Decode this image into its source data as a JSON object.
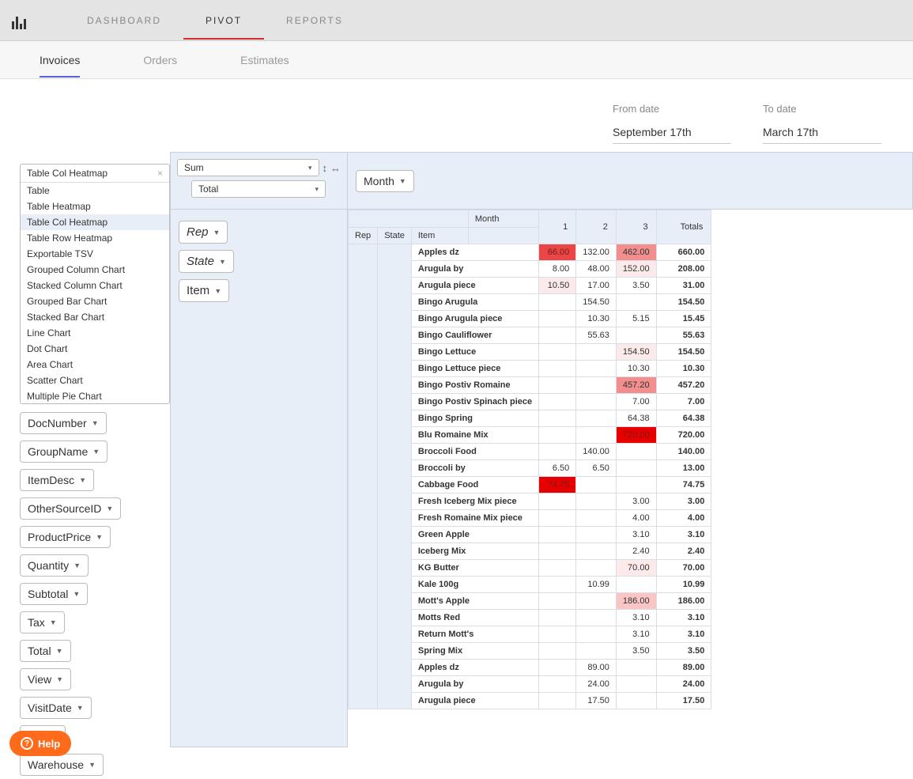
{
  "topTabs": [
    "DASHBOARD",
    "PIVOT",
    "REPORTS"
  ],
  "topActive": 1,
  "subTabs": [
    "Invoices",
    "Orders",
    "Estimates"
  ],
  "subActive": 0,
  "dates": {
    "fromLabel": "From date",
    "fromVal": "September 17th",
    "toLabel": "To date",
    "toVal": "March 17th"
  },
  "chartTypeSelected": "Table Col Heatmap",
  "chartTypes": [
    "Table",
    "Table Heatmap",
    "Table Col Heatmap",
    "Table Row Heatmap",
    "Exportable TSV",
    "Grouped Column Chart",
    "Stacked Column Chart",
    "Grouped Bar Chart",
    "Stacked Bar Chart",
    "Line Chart",
    "Dot Chart",
    "Area Chart",
    "Scatter Chart",
    "Multiple Pie Chart"
  ],
  "chartTypeSelIndex": 2,
  "aggFn": "Sum",
  "aggField": "Total",
  "rowFields": [
    "Rep",
    "State",
    "Item"
  ],
  "colFields": [
    "Month"
  ],
  "unusedFields": [
    "DocNumber",
    "GroupName",
    "ItemDesc",
    "OtherSourceID",
    "ProductPrice",
    "Quantity",
    "Subtotal",
    "Tax",
    "Total",
    "View",
    "VisitDate",
    "tion",
    "Warehouse"
  ],
  "monthLabel": "Month",
  "cornerCols": [
    "Rep",
    "State",
    "Item"
  ],
  "monthCols": [
    "1",
    "2",
    "3"
  ],
  "totalsLabel": "Totals",
  "rows": [
    {
      "item": "Apples dz",
      "v": [
        {
          "n": "66.00",
          "h": 4
        },
        {
          "n": "132.00",
          "h": 0
        },
        {
          "n": "462.00",
          "h": 3
        }
      ],
      "t": "660.00"
    },
    {
      "item": "Arugula by",
      "v": [
        {
          "n": "8.00",
          "h": 0
        },
        {
          "n": "48.00",
          "h": 0
        },
        {
          "n": "152.00",
          "h": 1
        }
      ],
      "t": "208.00"
    },
    {
      "item": "Arugula piece",
      "v": [
        {
          "n": "10.50",
          "h": 1
        },
        {
          "n": "17.00",
          "h": 0
        },
        {
          "n": "3.50",
          "h": 0
        }
      ],
      "t": "31.00"
    },
    {
      "item": "Bingo Arugula",
      "v": [
        {
          "n": "",
          "h": 0
        },
        {
          "n": "154.50",
          "h": 0
        },
        {
          "n": "",
          "h": 0
        }
      ],
      "t": "154.50"
    },
    {
      "item": "Bingo Arugula piece",
      "v": [
        {
          "n": "",
          "h": 0
        },
        {
          "n": "10.30",
          "h": 0
        },
        {
          "n": "5.15",
          "h": 0
        }
      ],
      "t": "15.45"
    },
    {
      "item": "Bingo Cauliflower",
      "v": [
        {
          "n": "",
          "h": 0
        },
        {
          "n": "55.63",
          "h": 0
        },
        {
          "n": "",
          "h": 0
        }
      ],
      "t": "55.63"
    },
    {
      "item": "Bingo Lettuce",
      "v": [
        {
          "n": "",
          "h": 0
        },
        {
          "n": "",
          "h": 0
        },
        {
          "n": "154.50",
          "h": 1
        }
      ],
      "t": "154.50"
    },
    {
      "item": "Bingo Lettuce piece",
      "v": [
        {
          "n": "",
          "h": 0
        },
        {
          "n": "",
          "h": 0
        },
        {
          "n": "10.30",
          "h": 0
        }
      ],
      "t": "10.30"
    },
    {
      "item": "Bingo Postiv Romaine",
      "v": [
        {
          "n": "",
          "h": 0
        },
        {
          "n": "",
          "h": 0
        },
        {
          "n": "457.20",
          "h": 3
        }
      ],
      "t": "457.20"
    },
    {
      "item": "Bingo Postiv Spinach piece",
      "v": [
        {
          "n": "",
          "h": 0
        },
        {
          "n": "",
          "h": 0
        },
        {
          "n": "7.00",
          "h": 0
        }
      ],
      "t": "7.00"
    },
    {
      "item": "Bingo Spring",
      "v": [
        {
          "n": "",
          "h": 0
        },
        {
          "n": "",
          "h": 0
        },
        {
          "n": "64.38",
          "h": 0
        }
      ],
      "t": "64.38"
    },
    {
      "item": "Blu Romaine Mix",
      "v": [
        {
          "n": "",
          "h": 0
        },
        {
          "n": "",
          "h": 0
        },
        {
          "n": "720.00",
          "h": 5
        }
      ],
      "t": "720.00"
    },
    {
      "item": "Broccoli Food",
      "v": [
        {
          "n": "",
          "h": 0
        },
        {
          "n": "140.00",
          "h": 0
        },
        {
          "n": "",
          "h": 0
        }
      ],
      "t": "140.00"
    },
    {
      "item": "Broccoli by",
      "v": [
        {
          "n": "6.50",
          "h": 0
        },
        {
          "n": "6.50",
          "h": 0
        },
        {
          "n": "",
          "h": 0
        }
      ],
      "t": "13.00"
    },
    {
      "item": "Cabbage Food",
      "v": [
        {
          "n": "74.75",
          "h": 5
        },
        {
          "n": "",
          "h": 0
        },
        {
          "n": "",
          "h": 0
        }
      ],
      "t": "74.75"
    },
    {
      "item": "Fresh Iceberg Mix piece",
      "v": [
        {
          "n": "",
          "h": 0
        },
        {
          "n": "",
          "h": 0
        },
        {
          "n": "3.00",
          "h": 0
        }
      ],
      "t": "3.00"
    },
    {
      "item": "Fresh Romaine Mix piece",
      "v": [
        {
          "n": "",
          "h": 0
        },
        {
          "n": "",
          "h": 0
        },
        {
          "n": "4.00",
          "h": 0
        }
      ],
      "t": "4.00"
    },
    {
      "item": "Green Apple",
      "v": [
        {
          "n": "",
          "h": 0
        },
        {
          "n": "",
          "h": 0
        },
        {
          "n": "3.10",
          "h": 0
        }
      ],
      "t": "3.10"
    },
    {
      "item": "Iceberg Mix",
      "v": [
        {
          "n": "",
          "h": 0
        },
        {
          "n": "",
          "h": 0
        },
        {
          "n": "2.40",
          "h": 0
        }
      ],
      "t": "2.40"
    },
    {
      "item": "KG Butter",
      "v": [
        {
          "n": "",
          "h": 0
        },
        {
          "n": "",
          "h": 0
        },
        {
          "n": "70.00",
          "h": 1
        }
      ],
      "t": "70.00"
    },
    {
      "item": "Kale 100g",
      "v": [
        {
          "n": "",
          "h": 0
        },
        {
          "n": "10.99",
          "h": 0
        },
        {
          "n": "",
          "h": 0
        }
      ],
      "t": "10.99"
    },
    {
      "item": "Mott's Apple",
      "v": [
        {
          "n": "",
          "h": 0
        },
        {
          "n": "",
          "h": 0
        },
        {
          "n": "186.00",
          "h": 2
        }
      ],
      "t": "186.00"
    },
    {
      "item": "Motts Red",
      "v": [
        {
          "n": "",
          "h": 0
        },
        {
          "n": "",
          "h": 0
        },
        {
          "n": "3.10",
          "h": 0
        }
      ],
      "t": "3.10"
    },
    {
      "item": "Return Mott's",
      "v": [
        {
          "n": "",
          "h": 0
        },
        {
          "n": "",
          "h": 0
        },
        {
          "n": "3.10",
          "h": 0
        }
      ],
      "t": "3.10"
    },
    {
      "item": "Spring Mix",
      "v": [
        {
          "n": "",
          "h": 0
        },
        {
          "n": "",
          "h": 0
        },
        {
          "n": "3.50",
          "h": 0
        }
      ],
      "t": "3.50"
    },
    {
      "item": "Apples dz",
      "v": [
        {
          "n": "",
          "h": 0
        },
        {
          "n": "89.00",
          "h": 0
        },
        {
          "n": "",
          "h": 0
        }
      ],
      "t": "89.00"
    },
    {
      "item": "Arugula by",
      "v": [
        {
          "n": "",
          "h": 0
        },
        {
          "n": "24.00",
          "h": 0
        },
        {
          "n": "",
          "h": 0
        }
      ],
      "t": "24.00"
    },
    {
      "item": "Arugula piece",
      "v": [
        {
          "n": "",
          "h": 0
        },
        {
          "n": "17.50",
          "h": 0
        },
        {
          "n": "",
          "h": 0
        }
      ],
      "t": "17.50"
    }
  ],
  "help": "Help"
}
